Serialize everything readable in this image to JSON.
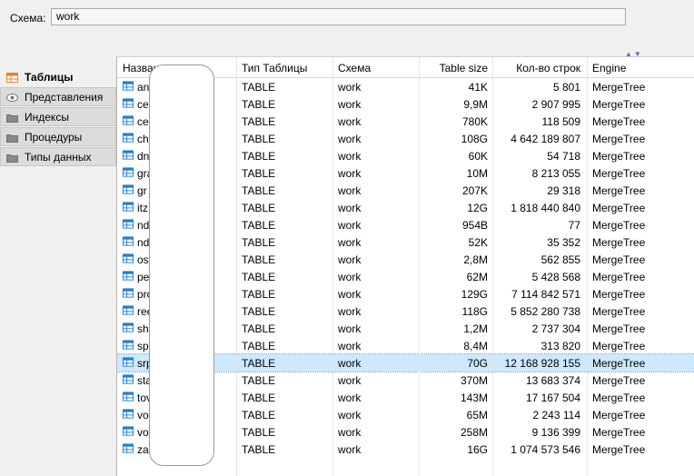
{
  "schema": {
    "label": "Схема:",
    "value": "work"
  },
  "sidebar": {
    "items": [
      {
        "label": "Таблицы",
        "icon": "table-icon",
        "active": true
      },
      {
        "label": "Представления",
        "icon": "eye-icon",
        "active": false
      },
      {
        "label": "Индексы",
        "icon": "folder-icon",
        "active": false
      },
      {
        "label": "Процедуры",
        "icon": "folder-icon",
        "active": false
      },
      {
        "label": "Типы данных",
        "icon": "folder-icon",
        "active": false
      }
    ]
  },
  "table": {
    "columns": [
      {
        "label": "Назван",
        "align": "left"
      },
      {
        "label": "Тип Таблицы",
        "align": "left"
      },
      {
        "label": "Схема",
        "align": "left"
      },
      {
        "label": "Table size",
        "align": "right"
      },
      {
        "label": "Кол-во строк",
        "align": "right"
      },
      {
        "label": "Engine",
        "align": "left"
      }
    ],
    "rows": [
      {
        "name": "an",
        "type": "TABLE",
        "schema": "work",
        "size": "41K",
        "rows": "5 801",
        "engine": "MergeTree"
      },
      {
        "name": "ce",
        "type": "TABLE",
        "schema": "work",
        "size": "9,9M",
        "rows": "2 907 995",
        "engine": "MergeTree"
      },
      {
        "name": "ce",
        "type": "TABLE",
        "schema": "work",
        "size": "780K",
        "rows": "118 509",
        "engine": "MergeTree"
      },
      {
        "name": "ch",
        "type": "TABLE",
        "schema": "work",
        "size": "108G",
        "rows": "4 642 189 807",
        "engine": "MergeTree"
      },
      {
        "name": "dn",
        "type": "TABLE",
        "schema": "work",
        "size": "60K",
        "rows": "54 718",
        "engine": "MergeTree"
      },
      {
        "name": "gra",
        "type": "TABLE",
        "schema": "work",
        "size": "10M",
        "rows": "8 213 055",
        "engine": "MergeTree"
      },
      {
        "name": "gr",
        "type": "TABLE",
        "schema": "work",
        "size": "207K",
        "rows": "29 318",
        "engine": "MergeTree"
      },
      {
        "name": "itz",
        "type": "TABLE",
        "schema": "work",
        "size": "12G",
        "rows": "1 818 440 840",
        "engine": "MergeTree"
      },
      {
        "name": "nd",
        "type": "TABLE",
        "schema": "work",
        "size": "954B",
        "rows": "77",
        "engine": "MergeTree"
      },
      {
        "name": "nd",
        "type": "TABLE",
        "schema": "work",
        "size": "52K",
        "rows": "35 352",
        "engine": "MergeTree"
      },
      {
        "name": "os",
        "type": "TABLE",
        "schema": "work",
        "size": "2,8M",
        "rows": "562 855",
        "engine": "MergeTree"
      },
      {
        "name": "pe",
        "type": "TABLE",
        "schema": "work",
        "size": "62M",
        "rows": "5 428 568",
        "engine": "MergeTree"
      },
      {
        "name": "pro",
        "type": "TABLE",
        "schema": "work",
        "size": "129G",
        "rows": "7 114 842 571",
        "engine": "MergeTree"
      },
      {
        "name": "ree",
        "type": "TABLE",
        "schema": "work",
        "size": "118G",
        "rows": "5 852 280 738",
        "engine": "MergeTree"
      },
      {
        "name": "sh",
        "type": "TABLE",
        "schema": "work",
        "size": "1,2M",
        "rows": "2 737 304",
        "engine": "MergeTree"
      },
      {
        "name": "sp",
        "type": "TABLE",
        "schema": "work",
        "size": "8,4M",
        "rows": "313 820",
        "engine": "MergeTree"
      },
      {
        "name": "srp",
        "type": "TABLE",
        "schema": "work",
        "size": "70G",
        "rows": "12 168 928 155",
        "engine": "MergeTree",
        "selected": true
      },
      {
        "name": "sta",
        "type": "TABLE",
        "schema": "work",
        "size": "370M",
        "rows": "13 683 374",
        "engine": "MergeTree"
      },
      {
        "name": "tov",
        "type": "TABLE",
        "schema": "work",
        "size": "143M",
        "rows": "17 167 504",
        "engine": "MergeTree"
      },
      {
        "name": "vo",
        "type": "TABLE",
        "schema": "work",
        "size": "65M",
        "rows": "2 243 114",
        "engine": "MergeTree"
      },
      {
        "name": "vo",
        "type": "TABLE",
        "schema": "work",
        "size": "258M",
        "rows": "9 136 399",
        "engine": "MergeTree"
      },
      {
        "name": "zal",
        "type": "TABLE",
        "schema": "work",
        "size": "16G",
        "rows": "1 074 573 546",
        "engine": "MergeTree"
      }
    ]
  },
  "colors": {
    "selected_row": "#cde8ff",
    "table_icon": "#1e7fd0",
    "sort_arrow": "#6b62c7"
  }
}
